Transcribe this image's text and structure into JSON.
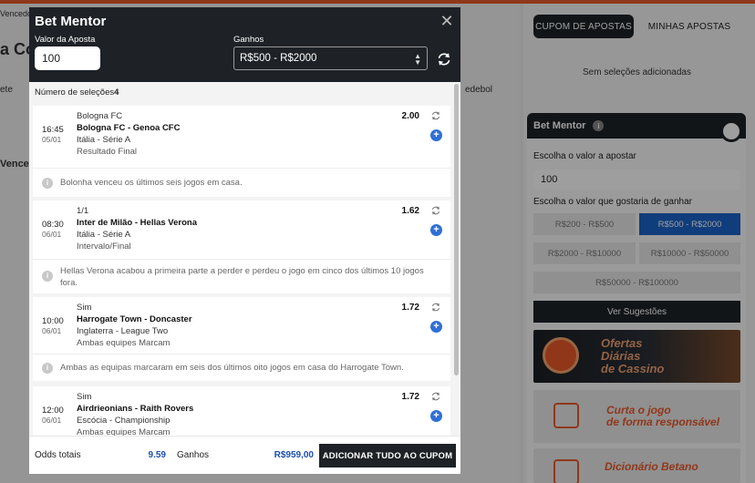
{
  "background": {
    "left_fragments": {
      "top_label": "Vencedo",
      "heading": "a Co",
      "row_label_1": "ete",
      "row_label_2": "edebol",
      "section_label": "Vencedo"
    },
    "right_panel": {
      "tab_active": "CUPOM DE APOSTAS",
      "tab_inactive": "MINHAS APOSTAS",
      "empty_state": "Sem seleções adicionadas",
      "bet_mentor_title": "Bet Mentor",
      "stake_label": "Escolha o valor a apostar",
      "stake_value": "100",
      "win_label": "Escolha o valor que gostaria de ganhar",
      "options": [
        "R$200 - R$500",
        "R$500 - R$2000",
        "R$2000 - R$10000",
        "R$10000 - R$50000",
        "R$50000 - R$100000"
      ],
      "selected_option": "R$500 - R$2000",
      "suggestions_button": "Ver Sugestões",
      "banner_casino": "Ofertas\nDiárias\nde Cassino",
      "banner_responsible": "Curta o jogo\nde forma responsável",
      "banner_dictionary": "Dicionário Betano"
    }
  },
  "modal": {
    "title": "Bet Mentor",
    "stake_label": "Valor da Aposta",
    "stake_value": "100",
    "winnings_label": "Ganhos",
    "winnings_range": "R$500 - R$2000",
    "selections_label": "Número de seleções",
    "selections_count": "4",
    "cards": [
      {
        "market": "Bologna FC",
        "time": "16:45",
        "date": "05/01",
        "match": "Bologna FC - Genoa CFC",
        "league": "Itália - Série A",
        "submarket": "Resultado Final",
        "odd": "2.00",
        "note": "Bolonha venceu os últimos seis jogos em casa."
      },
      {
        "market": "1/1",
        "time": "08:30",
        "date": "06/01",
        "match": "Inter de Milão - Hellas Verona",
        "league": "Itália - Série A",
        "submarket": "Intervalo/Final",
        "odd": "1.62",
        "note": "Hellas Verona acabou a primeira parte a perder e perdeu o jogo em cinco dos últimos 10 jogos fora."
      },
      {
        "market": "Sim",
        "time": "10:00",
        "date": "06/01",
        "match": "Harrogate Town - Doncaster",
        "league": "Inglaterra - League Two",
        "submarket": "Ambas equipes Marcam",
        "odd": "1.72",
        "note": "Ambas as equipas marcaram em seis dos últimos oito jogos em casa do Harrogate Town."
      },
      {
        "market": "Sim",
        "time": "12:00",
        "date": "06/01",
        "match": "Airdrieonians - Raith Rovers",
        "league": "Escócia - Championship",
        "submarket": "Ambas equipes Marcam",
        "odd": "1.72",
        "note": ""
      }
    ],
    "footer": {
      "total_odds_label": "Odds totais",
      "total_odds_value": "9.59",
      "winnings_label": "Ganhos",
      "winnings_value": "R$959,00",
      "add_all_button": "ADICIONAR TUDO AO CUPOM"
    }
  },
  "colors": {
    "header_dark": "#1e2227",
    "accent_orange": "#e8592b",
    "selected_blue": "#1a63c8",
    "plus_blue": "#2f6fd6"
  }
}
